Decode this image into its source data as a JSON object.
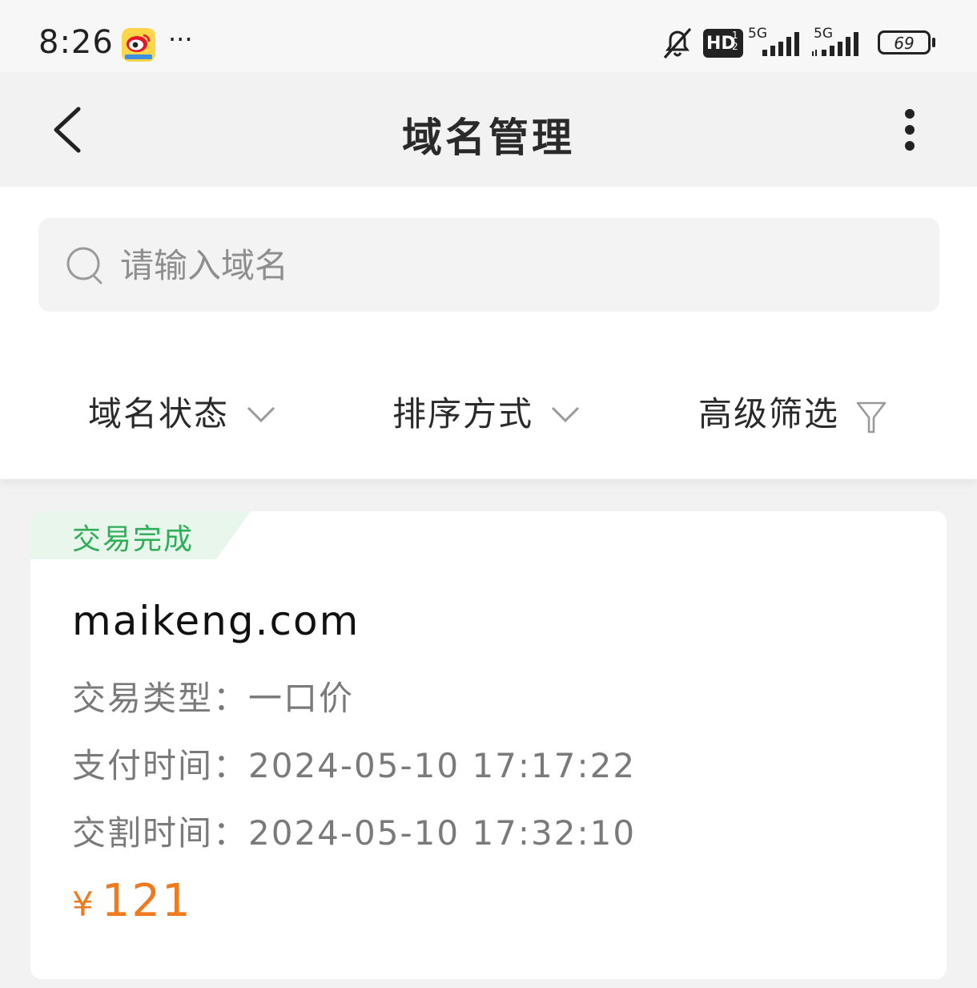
{
  "status_bar": {
    "time": "8:26",
    "more": "···",
    "hd_label": "HD",
    "net1": "5G",
    "net2": "5G",
    "battery": "69",
    "icons": [
      "weibo-app-icon",
      "bell-off-icon",
      "hd-icon",
      "signal-icon",
      "battery-icon"
    ]
  },
  "header": {
    "title": "域名管理",
    "icons": [
      "chevron-left-icon",
      "more-vertical-icon"
    ]
  },
  "search": {
    "placeholder": "请输入域名",
    "icon": "search-icon"
  },
  "filters": [
    {
      "label": "域名状态",
      "icon": "chevron-down-icon"
    },
    {
      "label": "排序方式",
      "icon": "chevron-down-icon"
    },
    {
      "label": "高级筛选",
      "icon": "filter-icon"
    }
  ],
  "card": {
    "status": "交易完成",
    "domain": "maikeng.com",
    "rows": [
      {
        "label": "交易类型：",
        "value": "一口价"
      },
      {
        "label": "支付时间：",
        "value": "2024-05-10 17:17:22"
      },
      {
        "label": "交割时间：",
        "value": "2024-05-10 17:32:10"
      }
    ],
    "currency": "¥",
    "price": "121"
  },
  "colors": {
    "status_green": "#2fae58",
    "tag_bg": "#e8f6ec",
    "price_orange": "#f07a1d",
    "page_bg": "#f2f2f2"
  }
}
